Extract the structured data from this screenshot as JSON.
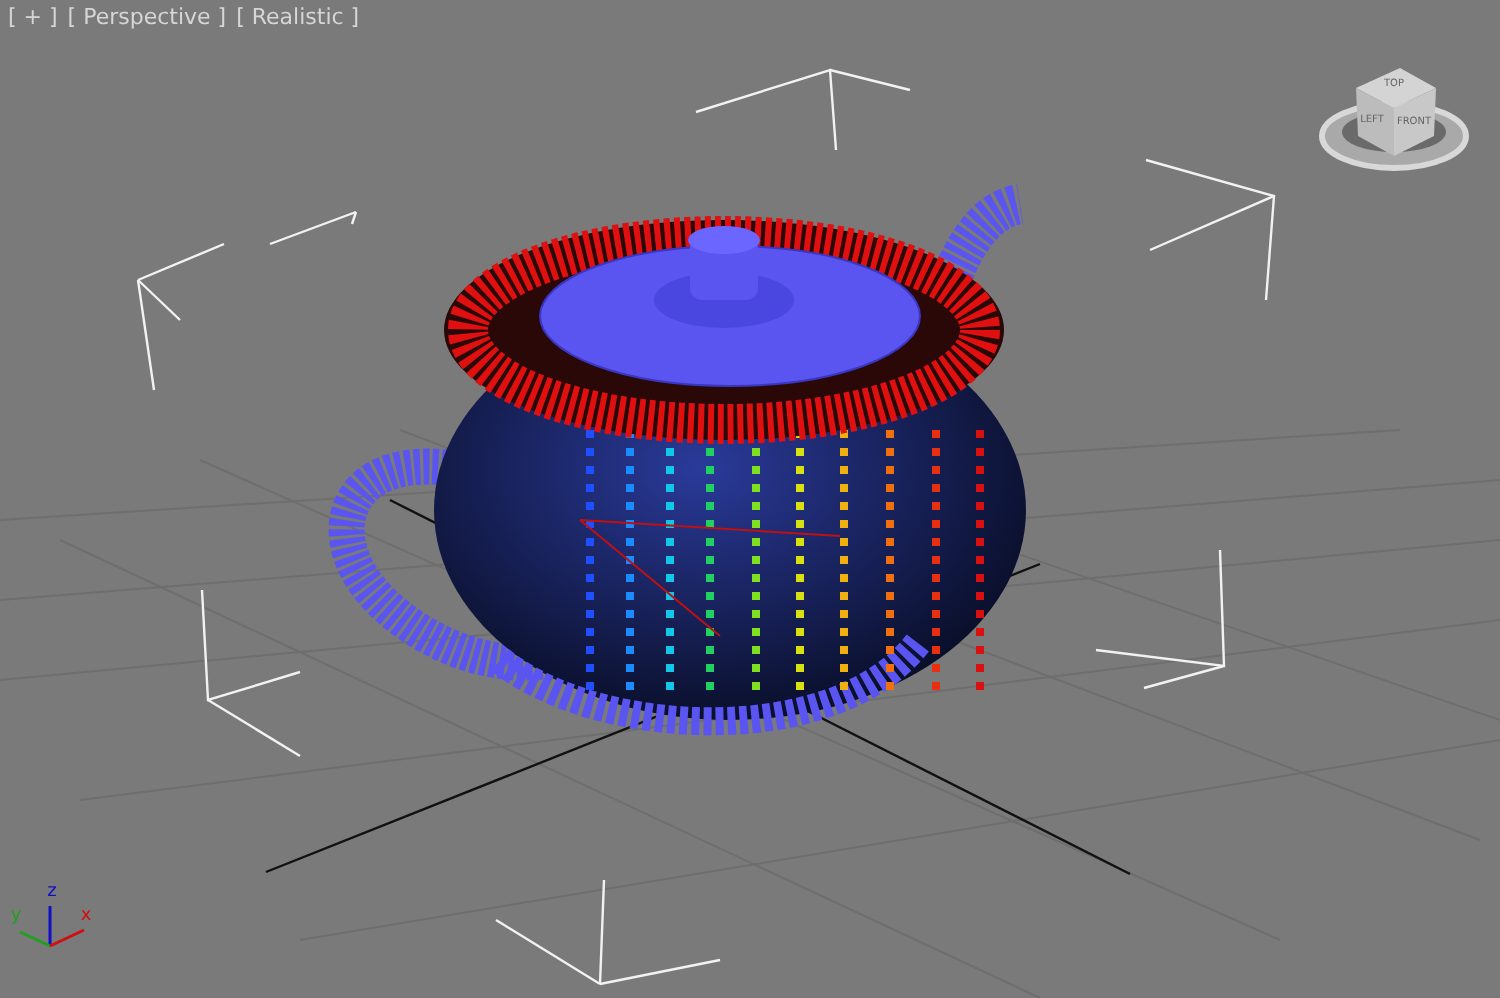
{
  "viewport_labels": [
    {
      "text": "[ + ]"
    },
    {
      "text": "[ Perspective ]"
    },
    {
      "text": "[ Realistic ]"
    }
  ],
  "viewcube": {
    "faces": [
      "TOP",
      "LEFT",
      "FRONT"
    ]
  },
  "axis_gizmo": {
    "labels": [
      "z",
      "y",
      "x"
    ]
  }
}
